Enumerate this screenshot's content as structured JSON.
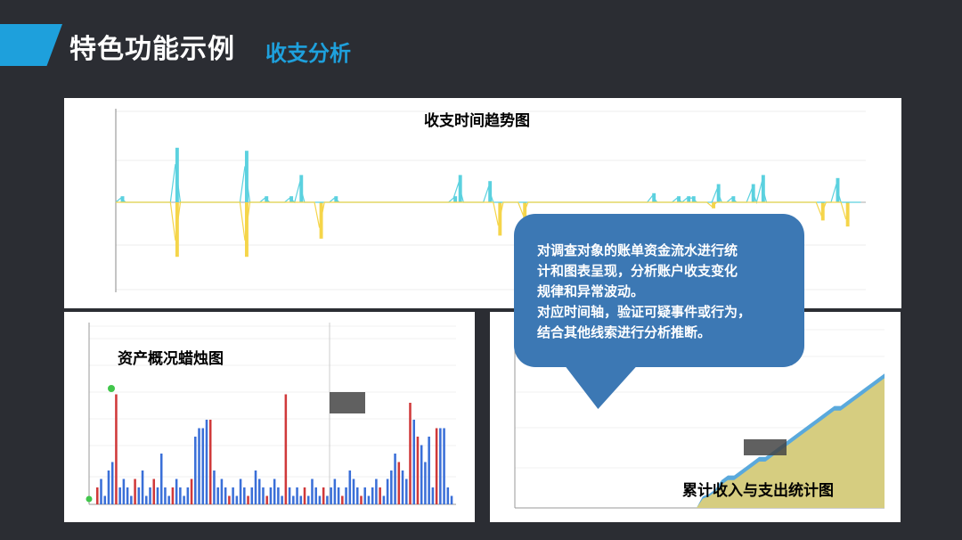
{
  "header": {
    "title": "特色功能示例",
    "subtitle": "收支分析"
  },
  "colors": {
    "accent": "#1ea0dc",
    "background": "#2b2d33",
    "income": "#5bd1df",
    "expense": "#f5d54a",
    "callout": "#3c78b4",
    "candle_up": "#d0393a",
    "candle_down": "#3a6fd8",
    "cumulative": "#d6cd80"
  },
  "callout": {
    "lines": [
      "对调查对象的账单资金流水进行统",
      "计和图表呈现，分析账户收支变化",
      "规律和异常波动。",
      "对应时间轴，验证可疑事件或行为，",
      "结合其他线索进行分析推断。"
    ]
  },
  "chart_data": [
    {
      "type": "bar",
      "title": "收支时间趋势图",
      "series": [
        {
          "name": "income",
          "values": [
            0,
            1,
            0,
            0,
            0,
            0,
            0,
            0,
            0,
            0,
            0,
            0,
            9,
            0,
            0,
            0,
            0,
            0,
            0,
            0,
            0,
            0,
            0,
            0,
            0,
            0,
            8.5,
            0,
            0,
            0,
            1,
            0,
            0,
            0,
            0,
            1,
            0,
            4.5,
            0,
            0,
            0,
            0,
            0,
            0,
            1,
            0,
            0,
            0,
            0,
            0,
            0,
            0,
            0,
            0,
            0,
            0,
            0,
            0,
            0,
            0,
            0,
            0,
            0,
            0,
            0,
            0,
            0,
            0,
            1,
            4.5,
            0,
            0,
            0,
            0,
            0,
            3.5,
            0,
            0,
            0,
            0,
            0,
            0,
            0,
            0,
            0,
            0,
            0,
            0,
            0,
            0,
            0,
            0,
            0,
            0,
            0,
            0,
            0,
            0,
            0,
            0,
            0,
            0,
            0,
            0,
            0,
            0,
            0,
            0,
            1.5,
            0,
            0,
            0,
            0,
            1,
            0,
            1,
            1,
            0,
            0,
            0,
            0,
            3,
            0,
            0,
            1,
            0,
            0,
            0,
            3,
            0,
            4.5,
            0,
            0,
            0,
            0,
            0,
            0,
            0,
            0,
            0,
            0,
            0,
            0,
            0,
            0,
            4,
            0,
            0,
            0,
            0,
            0
          ]
        },
        {
          "name": "expense",
          "values": [
            0,
            0,
            0,
            0,
            0,
            0,
            0,
            0,
            0,
            0,
            0,
            0,
            -9,
            0,
            0,
            0,
            0,
            0,
            0,
            0,
            0,
            0,
            0,
            0,
            0,
            0,
            -9,
            0,
            0,
            0,
            0,
            0,
            0,
            0,
            0,
            0,
            0,
            0,
            0,
            0,
            0,
            -6,
            0,
            0,
            0,
            0,
            0,
            0,
            0,
            0,
            0,
            0,
            0,
            0,
            0,
            0,
            0,
            0,
            0,
            0,
            0,
            0,
            0,
            0,
            0,
            0,
            0,
            0,
            0,
            0,
            0,
            0,
            0,
            0,
            0,
            0,
            0,
            -5.5,
            0,
            0,
            0,
            0,
            -3,
            0,
            0,
            0,
            0,
            0,
            0,
            0,
            0,
            0,
            0,
            0,
            0,
            0,
            0,
            0,
            0,
            0,
            0,
            0,
            0,
            0,
            0,
            0,
            0,
            0,
            0,
            0,
            0,
            0,
            0,
            0,
            0,
            0,
            0,
            0,
            0,
            0,
            -1,
            0,
            0,
            0,
            0,
            0,
            0,
            0,
            0,
            0,
            0,
            0,
            0,
            0,
            0,
            0,
            0,
            0,
            0,
            0,
            0,
            0,
            -3,
            0,
            0,
            0,
            0,
            -4
          ]
        }
      ]
    },
    {
      "type": "bar",
      "title": "资产概况蜡烛图",
      "values": [
        2,
        3,
        1,
        4,
        5,
        13,
        2,
        3,
        2,
        1,
        3,
        2,
        4,
        1,
        2,
        3,
        2,
        6,
        2,
        1,
        2,
        3,
        2,
        1,
        2,
        3,
        8,
        9,
        9,
        10,
        10,
        4,
        2,
        3,
        2,
        1,
        2,
        1,
        3,
        2,
        1,
        2,
        4,
        3,
        2,
        1,
        2,
        3,
        2,
        1,
        13,
        2,
        1,
        2,
        1,
        2,
        1,
        3,
        2,
        1,
        2,
        1,
        2,
        3,
        2,
        1,
        2,
        4,
        3,
        2,
        1,
        2,
        1,
        2,
        3,
        2,
        1,
        3,
        4,
        6,
        5,
        4,
        3,
        12,
        10,
        8,
        7,
        5,
        8,
        2,
        9,
        9,
        9,
        2,
        1
      ]
    },
    {
      "type": "area",
      "title": "累计收入与支出统计图",
      "series": [
        {
          "name": "income",
          "values": [
            0,
            0,
            0,
            0,
            0,
            0,
            0,
            0,
            0,
            0,
            0,
            0,
            0,
            0,
            0,
            0,
            0,
            0,
            0,
            0,
            0,
            0,
            0,
            0,
            0,
            0,
            0,
            0,
            0,
            0,
            5,
            6,
            8,
            12,
            14,
            14,
            16,
            18,
            20,
            22,
            22,
            24,
            26,
            28,
            30,
            32,
            34,
            36,
            38,
            40,
            42,
            44,
            44,
            46,
            48,
            50,
            52,
            54,
            56,
            58
          ]
        },
        {
          "name": "expense",
          "values": [
            0,
            0,
            0,
            0,
            0,
            0,
            0,
            0,
            0,
            0,
            0,
            0,
            0,
            0,
            0,
            0,
            0,
            0,
            0,
            0,
            0,
            0,
            0,
            0,
            0,
            0,
            0,
            0,
            0,
            0,
            4,
            5,
            7,
            10,
            12,
            12,
            14,
            16,
            18,
            20,
            20,
            22,
            24,
            26,
            28,
            30,
            32,
            34,
            36,
            38,
            40,
            42,
            42,
            44,
            46,
            48,
            50,
            52,
            54,
            56
          ]
        }
      ]
    }
  ]
}
